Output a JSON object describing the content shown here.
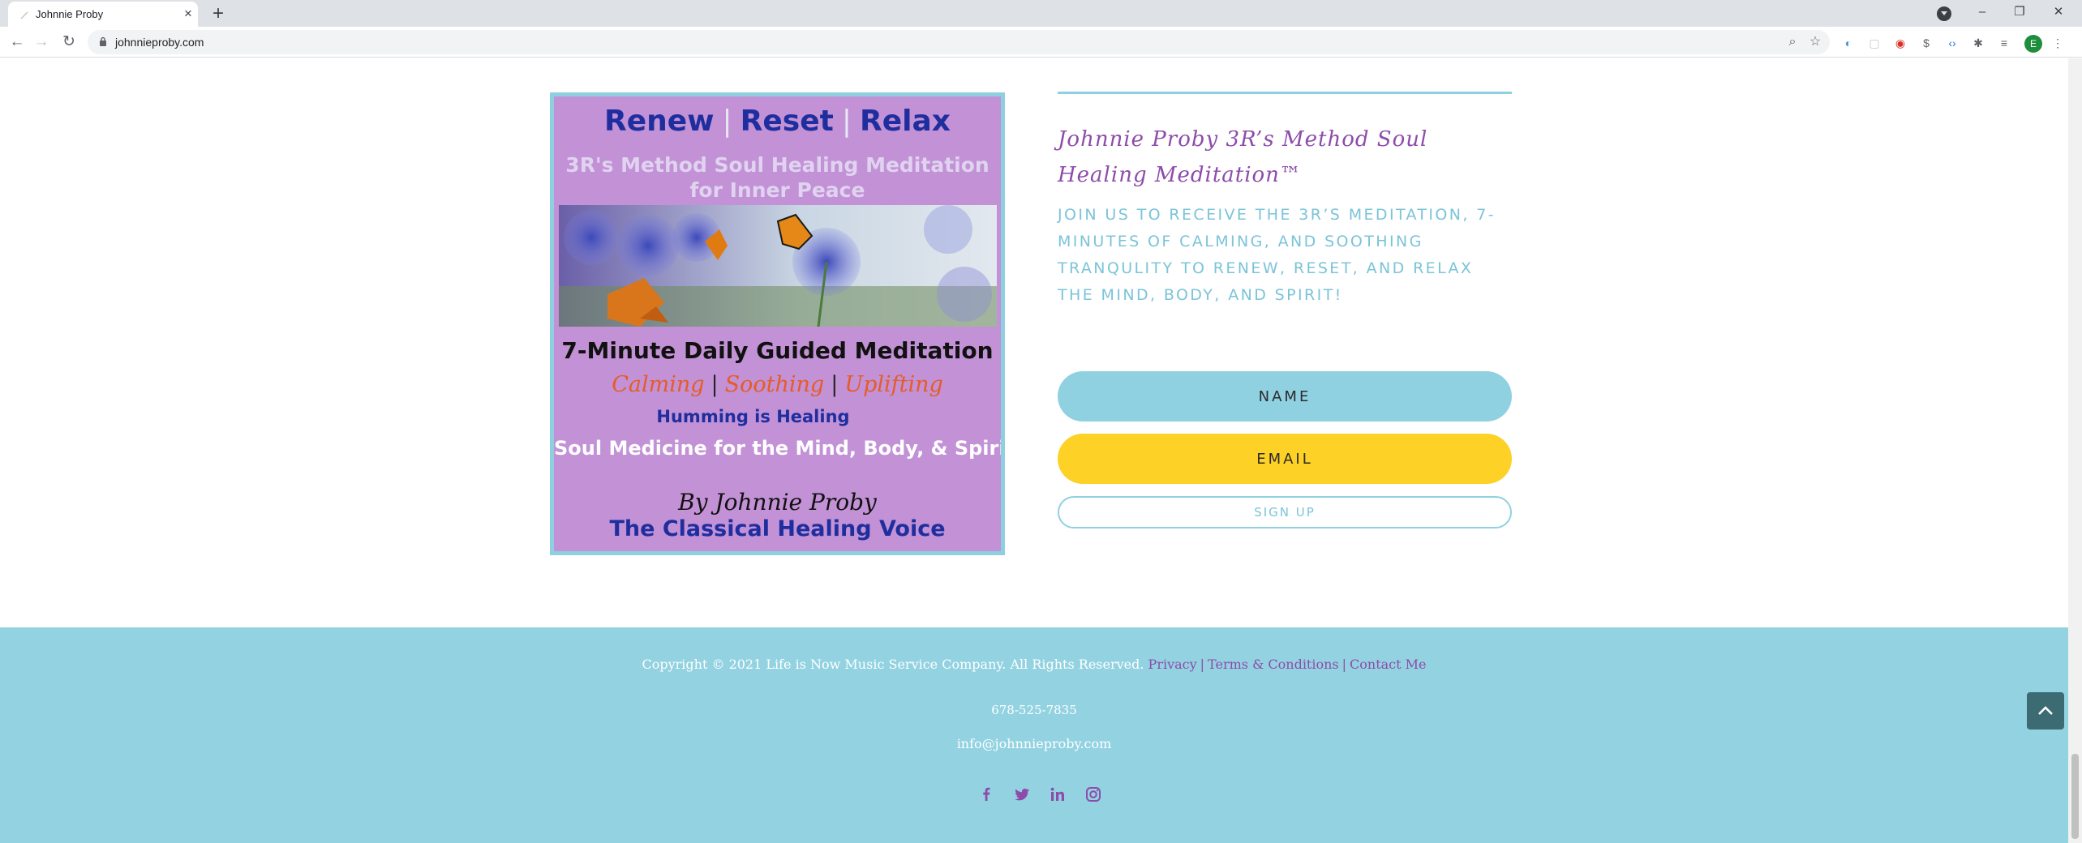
{
  "browser": {
    "tab_title": "Johnnie Proby",
    "new_tab_label": "+",
    "url": "johnnieproby.com",
    "profile_initial": "E",
    "icons": [
      "back-icon",
      "forward-icon",
      "reload-icon",
      "lock-icon",
      "zoom-icon",
      "star-icon",
      "extensions-icon",
      "menu-icon"
    ]
  },
  "poster": {
    "renew": "Renew",
    "reset": "Reset",
    "relax": "Relax",
    "subtitle_1": "3R's Method Soul Healing Meditation",
    "subtitle_2": "for Inner Peace",
    "headline": "7-Minute Daily Guided Meditation",
    "calming": "Calming",
    "soothing": "Soothing",
    "uplifting": "Uplifting",
    "humming": "Humming is Healing",
    "soul_medicine": "Soul Medicine for the Mind, Body, & Spirit",
    "byline": "By Johnnie Proby",
    "voice": "The Classical Healing Voice"
  },
  "signup": {
    "title": "Johnnie Proby 3R’s Method Soul Healing Meditation™",
    "description": "JOIN US TO RECEIVE THE 3R’S MEDITATION,  7-MINUTES OF CALMING, AND SOOTHING TRANQULITY TO RENEW, RESET, AND RELAX THE MIND, BODY, AND SPIRIT!",
    "name_placeholder": "NAME",
    "email_placeholder": "EMAIL",
    "button_label": "SIGN UP"
  },
  "footer": {
    "copyright": "Copyright © 2021 Life is Now Music Service Company. All Rights Reserved.",
    "privacy": "Privacy",
    "terms": "Terms & Conditions",
    "contact": "Contact Me",
    "separator": "|",
    "phone": "678-525-7835",
    "email": "info@johnnieproby.com",
    "socials": [
      "facebook-icon",
      "twitter-icon",
      "linkedin-icon",
      "instagram-icon"
    ]
  },
  "colors": {
    "accent_blue": "#92d2e1",
    "accent_purple": "#8e4caa",
    "email_yellow": "#fdd126",
    "poster_bg": "#c291d6"
  }
}
